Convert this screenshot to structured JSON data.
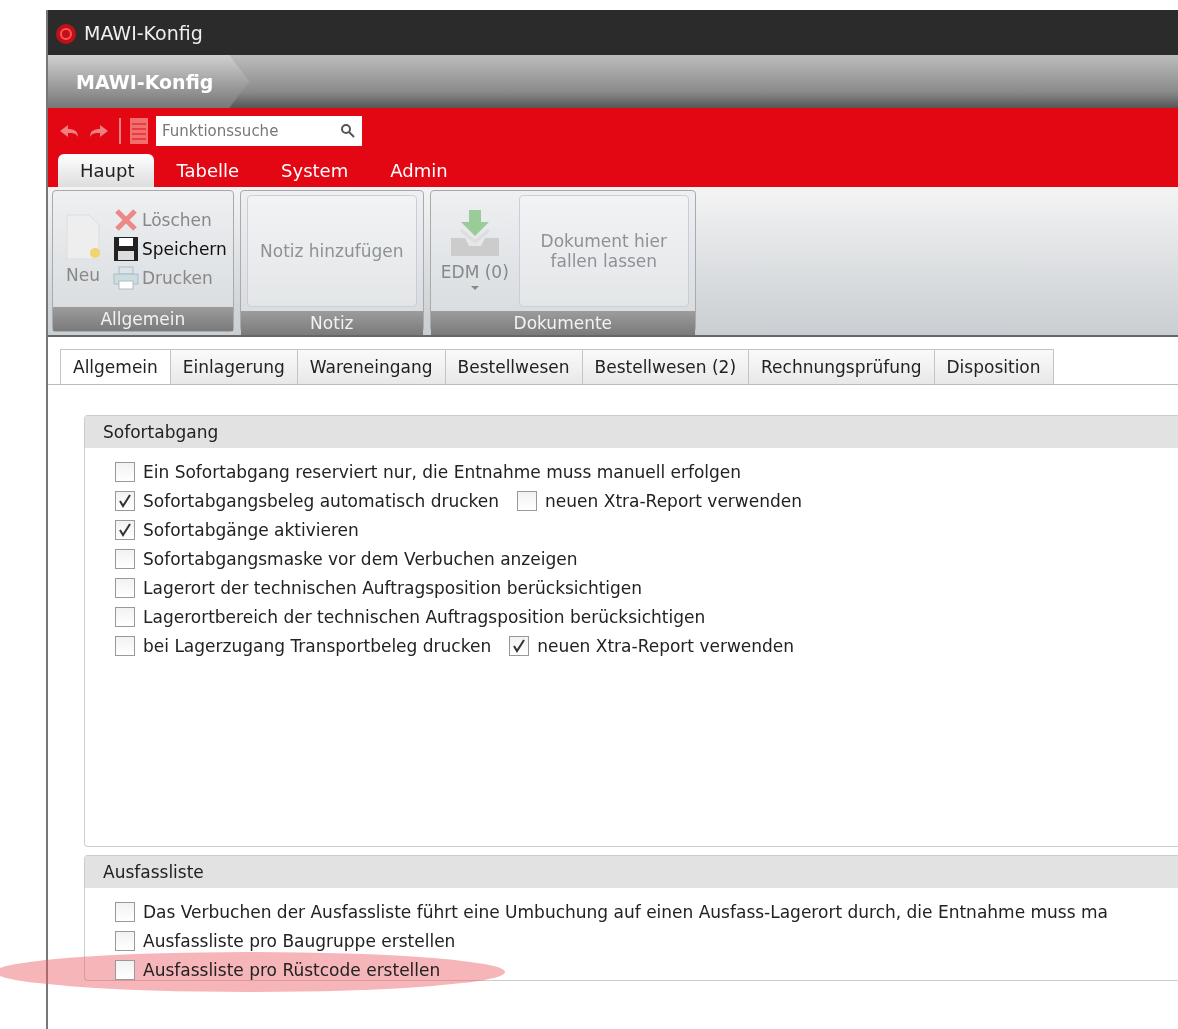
{
  "window": {
    "title": "MAWI-Konfig"
  },
  "breadcrumb": [
    "MAWI-Konfig"
  ],
  "toolbar": {
    "search": {
      "placeholder": "Funktionssuche"
    }
  },
  "ribbon_tabs": [
    {
      "label": "Haupt",
      "selected": true
    },
    {
      "label": "Tabelle",
      "selected": false
    },
    {
      "label": "System",
      "selected": false
    },
    {
      "label": "Admin",
      "selected": false
    }
  ],
  "ribbon_groups": [
    {
      "title": "Allgemein",
      "buttons": [
        {
          "kind": "new",
          "label": "Neu",
          "disabled": true
        },
        {
          "kind": "delete",
          "label": "Löschen",
          "disabled": true
        },
        {
          "kind": "save",
          "label": "Speichern",
          "disabled": false
        },
        {
          "kind": "print",
          "label": "Drucken",
          "disabled": true
        }
      ]
    },
    {
      "title": "Notiz",
      "buttons": [
        {
          "kind": "panel",
          "label": "Notiz hinzufügen",
          "disabled": true
        }
      ]
    },
    {
      "title": "Dokumente",
      "buttons": [
        {
          "kind": "inbox",
          "label": "EDM (0)",
          "disabled": true,
          "dropdown": true
        },
        {
          "kind": "panel",
          "label": "Dokument hier fallen lassen",
          "disabled": true
        }
      ]
    }
  ],
  "page_tabs": [
    {
      "label": "Allgemein",
      "selected": true
    },
    {
      "label": "Einlagerung",
      "selected": false
    },
    {
      "label": "Wareneingang",
      "selected": false
    },
    {
      "label": "Bestellwesen",
      "selected": false
    },
    {
      "label": "Bestellwesen (2)",
      "selected": false
    },
    {
      "label": "Rechnungsprüfung",
      "selected": false
    },
    {
      "label": "Disposition",
      "selected": false
    }
  ],
  "sections": [
    {
      "title": "Sofortabgang",
      "rows": [
        {
          "items": [
            {
              "label": "Ein Sofortabgang reserviert nur, die Entnahme muss manuell erfolgen",
              "checked": false
            }
          ]
        },
        {
          "items": [
            {
              "label": "Sofortabgangsbeleg automatisch drucken",
              "checked": true
            },
            {
              "label": "neuen Xtra-Report verwenden",
              "checked": false
            }
          ]
        },
        {
          "items": [
            {
              "label": "Sofortabgänge aktivieren",
              "checked": true
            }
          ]
        },
        {
          "items": [
            {
              "label": "Sofortabgangsmaske vor dem Verbuchen anzeigen",
              "checked": false
            }
          ]
        },
        {
          "items": [
            {
              "label": "Lagerort der technischen Auftragsposition berücksichtigen",
              "checked": false
            }
          ]
        },
        {
          "items": [
            {
              "label": "Lagerortbereich der technischen Auftragsposition berücksichtigen",
              "checked": false
            }
          ]
        },
        {
          "items": [
            {
              "label": "bei Lagerzugang Transportbeleg drucken",
              "checked": false
            },
            {
              "label": "neuen Xtra-Report verwenden",
              "checked": true
            }
          ]
        }
      ]
    },
    {
      "title": "Ausfassliste",
      "rows": [
        {
          "items": [
            {
              "label": "Das Verbuchen der Ausfassliste führt eine Umbuchung auf einen Ausfass-Lagerort durch, die Entnahme muss ma",
              "checked": false
            }
          ]
        },
        {
          "items": [
            {
              "label": "Ausfassliste pro Baugruppe erstellen",
              "checked": false
            }
          ]
        },
        {
          "items": [
            {
              "label": "Ausfassliste pro Rüstcode erstellen",
              "checked": false
            }
          ],
          "highlighted": true
        }
      ]
    }
  ]
}
